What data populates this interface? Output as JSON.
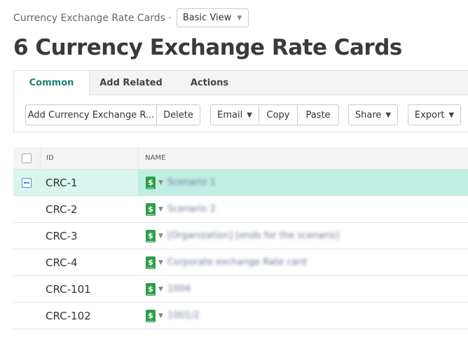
{
  "breadcrumb": {
    "label": "Currency Exchange Rate Cards ·"
  },
  "view_selector": {
    "value": "Basic View"
  },
  "page_title": "6 Currency Exchange Rate Cards",
  "tabs": [
    {
      "label": "Common"
    },
    {
      "label": "Add Related"
    },
    {
      "label": "Actions"
    }
  ],
  "toolbar": {
    "add_label": "Add Currency Exchange R...",
    "delete_label": "Delete",
    "email_label": "Email",
    "copy_label": "Copy",
    "paste_label": "Paste",
    "share_label": "Share",
    "export_label": "Export"
  },
  "table": {
    "columns": {
      "id": "ID",
      "name": "NAME"
    },
    "rows": [
      {
        "id": "CRC-1",
        "name": "Scenario 1",
        "selected": true
      },
      {
        "id": "CRC-2",
        "name": "Scenario 2",
        "selected": false
      },
      {
        "id": "CRC-3",
        "name": "[Organization] [ends for the scenario]",
        "selected": false
      },
      {
        "id": "CRC-4",
        "name": "Corporate exchange Rate card",
        "selected": false
      },
      {
        "id": "CRC-101",
        "name": "1004",
        "selected": false
      },
      {
        "id": "CRC-102",
        "name": "1001/2",
        "selected": false
      }
    ]
  },
  "colors": {
    "accent": "#1a7f7a",
    "selected_row": "#d9f5ee",
    "selected_name_cell": "#bfeee2",
    "icon_green": "#2e9e4a"
  },
  "icons": {
    "row_type": "dollar-card-icon",
    "row_menu": "caret-down-icon"
  }
}
